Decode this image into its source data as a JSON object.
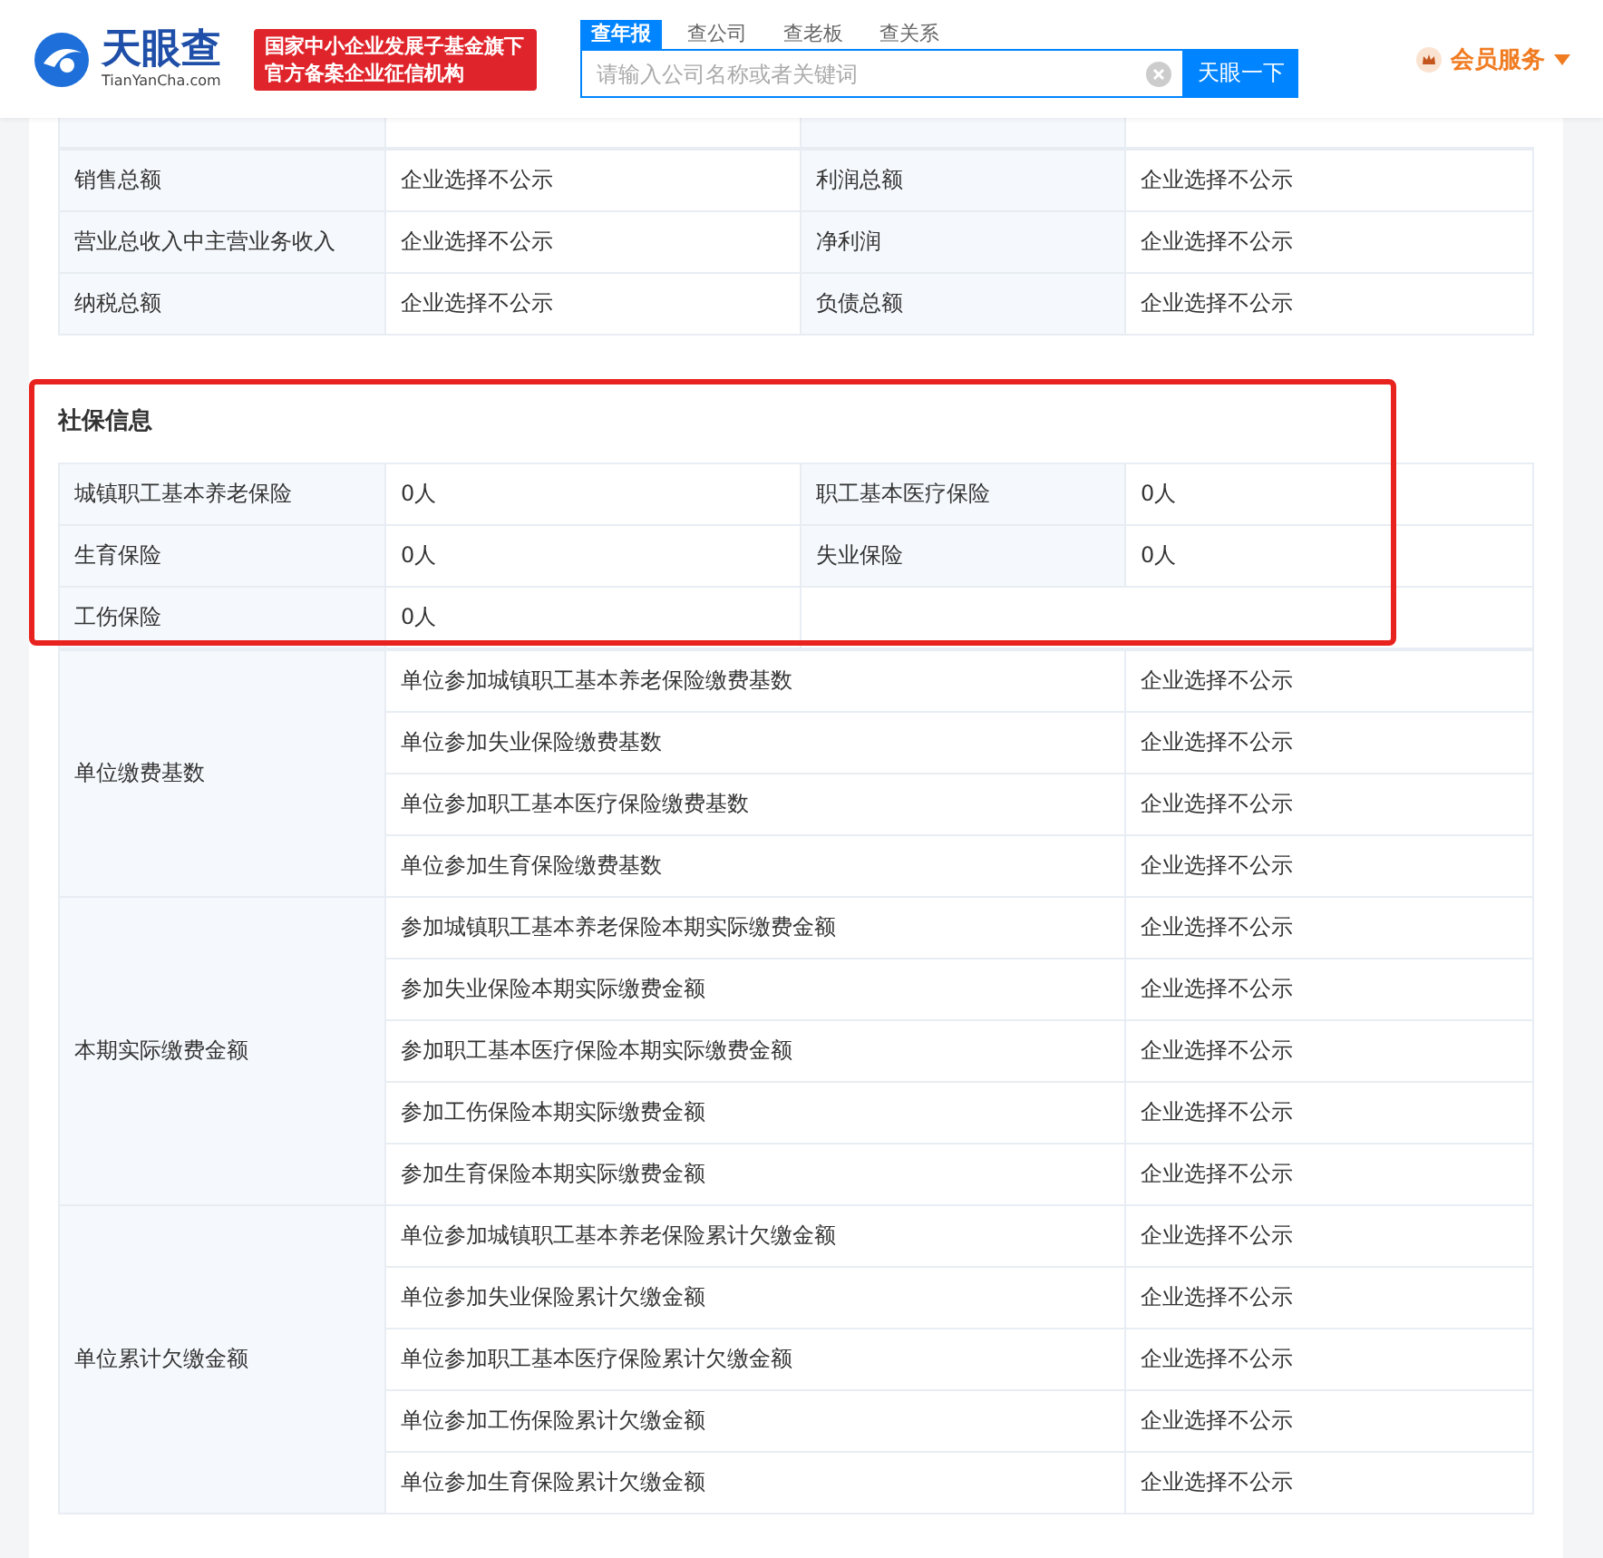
{
  "header": {
    "brand": "天眼查",
    "brand_domain": "TianYanCha.com",
    "badge_lines": [
      "国家中小企业发展子基金旗下",
      "官方备案企业征信机构"
    ],
    "search_tabs": [
      {
        "label": "查年报",
        "selected": true
      },
      {
        "label": "查公司",
        "selected": false
      },
      {
        "label": "查老板",
        "selected": false
      },
      {
        "label": "查关系",
        "selected": false
      }
    ],
    "search": {
      "placeholder": "请输入公司名称或者关键词"
    },
    "search_button": "天眼一下",
    "member_label": "会员服务"
  },
  "finance_rows": [
    [
      "销售总额",
      "企业选择不公示",
      "利润总额",
      "企业选择不公示"
    ],
    [
      "营业总收入中主营业务收入",
      "企业选择不公示",
      "净利润",
      "企业选择不公示"
    ],
    [
      "纳税总额",
      "企业选择不公示",
      "负债总额",
      "企业选择不公示"
    ]
  ],
  "social": {
    "title": "社保信息",
    "rows": [
      [
        "城镇职工基本养老保险",
        "0人",
        "职工基本医疗保险",
        "0人"
      ],
      [
        "生育保险",
        "0人",
        "失业保险",
        "0人"
      ],
      [
        "工伤保险",
        "0人"
      ]
    ],
    "groups": [
      {
        "label": "单位缴费基数",
        "items": [
          {
            "name": "单位参加城镇职工基本养老保险缴费基数",
            "value": "企业选择不公示"
          },
          {
            "name": "单位参加失业保险缴费基数",
            "value": "企业选择不公示"
          },
          {
            "name": "单位参加职工基本医疗保险缴费基数",
            "value": "企业选择不公示"
          },
          {
            "name": "单位参加生育保险缴费基数",
            "value": "企业选择不公示"
          }
        ]
      },
      {
        "label": "本期实际缴费金额",
        "items": [
          {
            "name": "参加城镇职工基本养老保险本期实际缴费金额",
            "value": "企业选择不公示"
          },
          {
            "name": "参加失业保险本期实际缴费金额",
            "value": "企业选择不公示"
          },
          {
            "name": "参加职工基本医疗保险本期实际缴费金额",
            "value": "企业选择不公示"
          },
          {
            "name": "参加工伤保险本期实际缴费金额",
            "value": "企业选择不公示"
          },
          {
            "name": "参加生育保险本期实际缴费金额",
            "value": "企业选择不公示"
          }
        ]
      },
      {
        "label": "单位累计欠缴金额",
        "items": [
          {
            "name": "单位参加城镇职工基本养老保险累计欠缴金额",
            "value": "企业选择不公示"
          },
          {
            "name": "单位参加失业保险累计欠缴金额",
            "value": "企业选择不公示"
          },
          {
            "name": "单位参加职工基本医疗保险累计欠缴金额",
            "value": "企业选择不公示"
          },
          {
            "name": "单位参加工伤保险累计欠缴金额",
            "value": "企业选择不公示"
          },
          {
            "name": "单位参加生育保险累计欠缴金额",
            "value": "企业选择不公示"
          }
        ]
      }
    ]
  }
}
